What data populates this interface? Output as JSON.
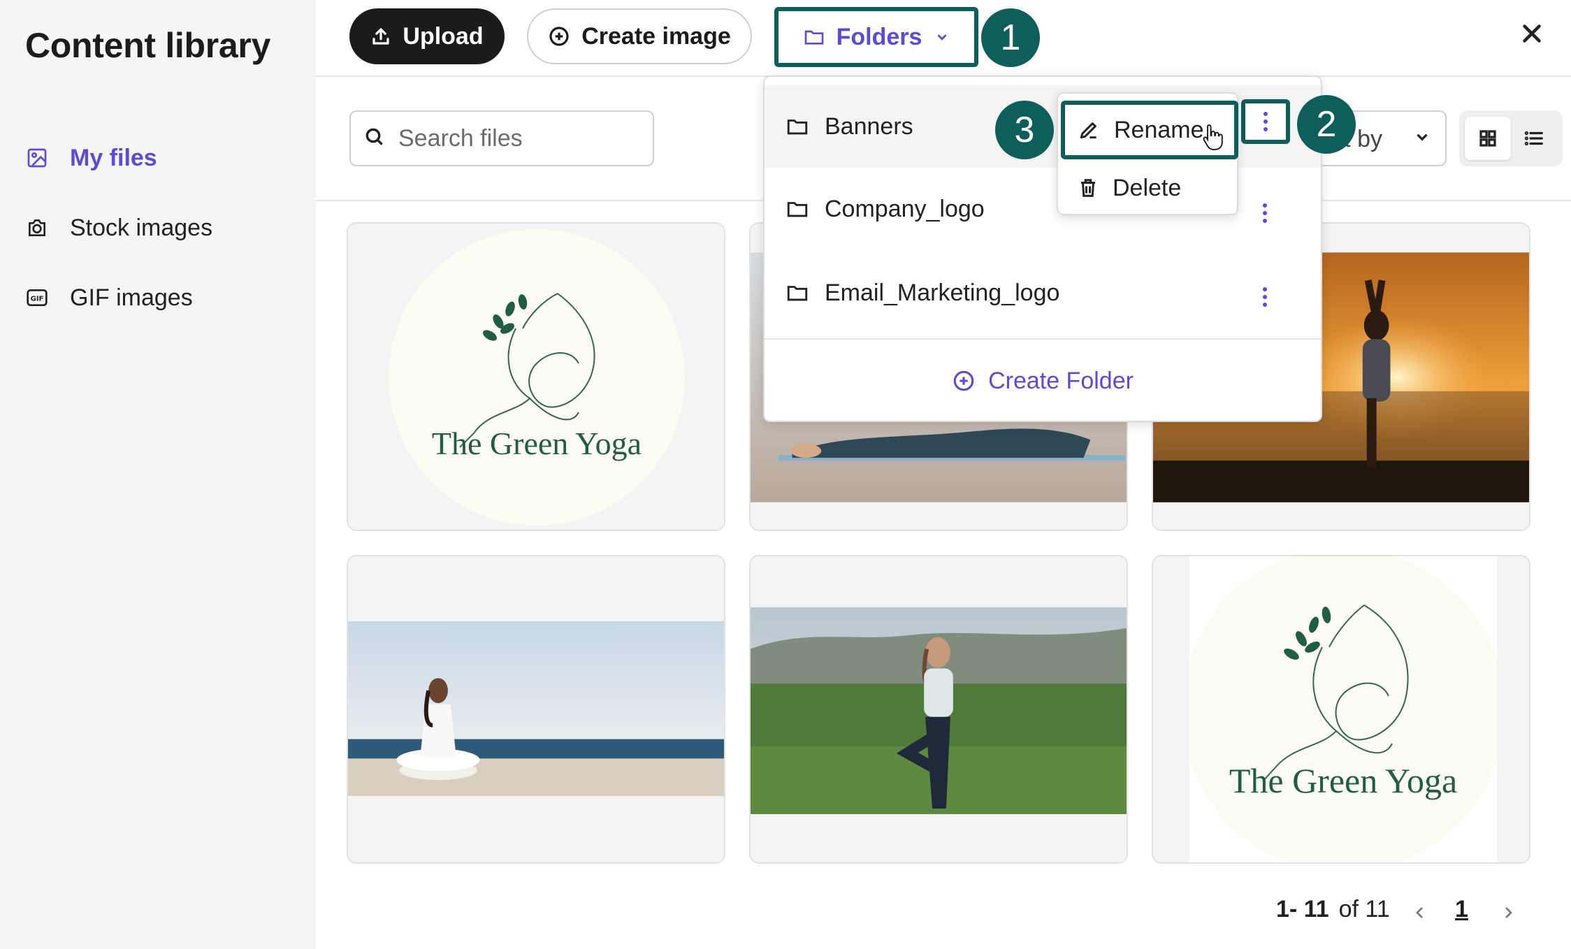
{
  "sidebar": {
    "title": "Content library",
    "items": [
      {
        "label": "My files",
        "icon": "image-icon",
        "active": true
      },
      {
        "label": "Stock images",
        "icon": "camera-icon",
        "active": false
      },
      {
        "label": "GIF images",
        "icon": "gif-icon",
        "active": false
      }
    ]
  },
  "toolbar": {
    "upload_label": "Upload",
    "create_image_label": "Create image",
    "folders_label": "Folders"
  },
  "filters": {
    "search_placeholder": "Search files",
    "sort_label": "Sort by"
  },
  "folders_menu": {
    "items": [
      {
        "name": "Banners"
      },
      {
        "name": "Company_logo"
      },
      {
        "name": "Email_Marketing_logo"
      }
    ],
    "create_label": "Create Folder",
    "context_menu": {
      "rename_label": "Rename",
      "delete_label": "Delete"
    }
  },
  "grid": {
    "items": [
      {
        "type": "logo",
        "caption": "The Green Yoga"
      },
      {
        "type": "photo",
        "caption": ""
      },
      {
        "type": "photo",
        "caption": ""
      },
      {
        "type": "photo",
        "caption": ""
      },
      {
        "type": "photo",
        "caption": ""
      },
      {
        "type": "logo",
        "caption": "The Green Yoga"
      }
    ]
  },
  "pagination": {
    "range": "1- 11",
    "of_text": "of 11",
    "current_page": "1"
  },
  "step_badges": [
    "1",
    "2",
    "3"
  ],
  "colors": {
    "accent": "#5b4bd6",
    "highlight": "#0e5e5c",
    "dark_button": "#1b1b1b",
    "brand_green": "#1f5f3f"
  }
}
